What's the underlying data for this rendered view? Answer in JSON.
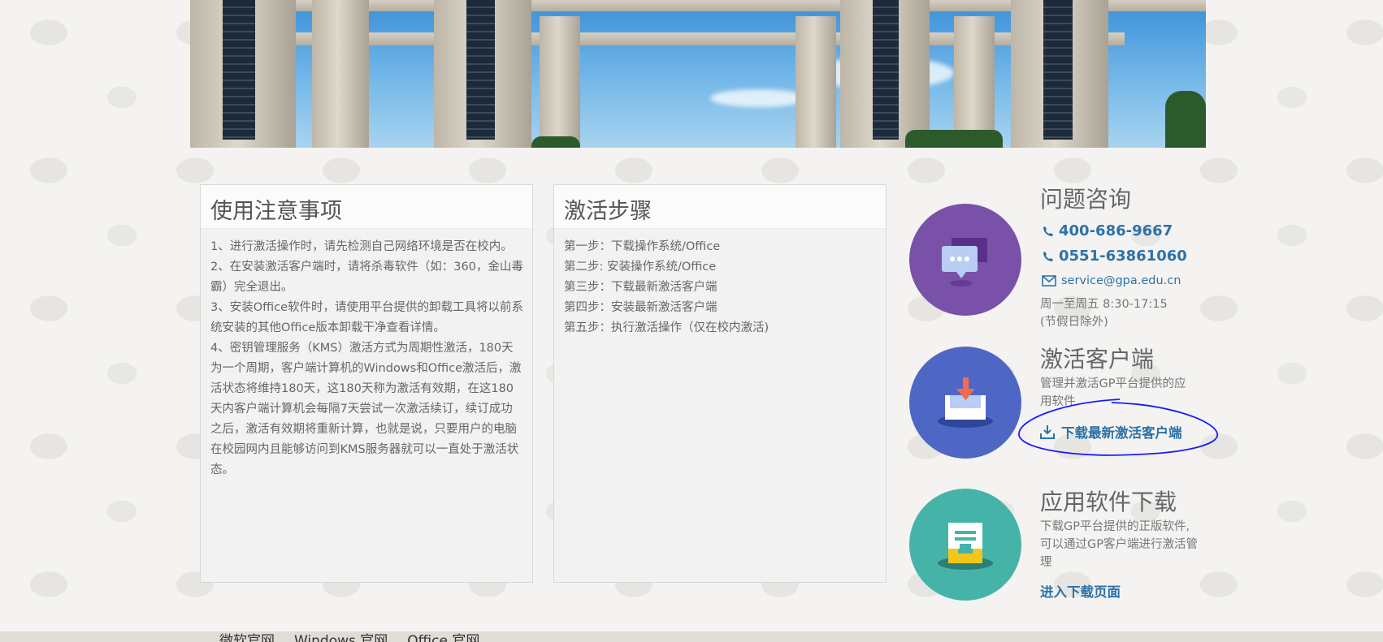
{
  "notes_card": {
    "title": "使用注意事项",
    "items": [
      "1、进行激活操作时，请先检测自己网络环境是否在校内。",
      "2、在安装激活客户端时，请将杀毒软件（如：360，金山毒霸）完全退出。",
      "3、安装Office软件时，请使用平台提供的卸载工具将以前系统安装的其他Office版本卸载干净查看详情。",
      "4、密钥管理服务（KMS）激活方式为周期性激活，180天为一个周期，客户端计算机的Windows和Office激活后，激活状态将维持180天，这180天称为激活有效期，在这180天内客户端计算机会每隔7天尝试一次激活续订，续订成功之后，激活有效期将重新计算，也就是说，只要用户的电脑在校园网内且能够访问到KMS服务器就可以一直处于激活状态。"
    ]
  },
  "steps_card": {
    "title": "激活步骤",
    "steps": [
      "第一步：下载操作系统/Office",
      "第二步: 安装操作系统/Office",
      "第三步：下载最新激活客户端",
      "第四步：安装最新激活客户端",
      "第五步：执行激活操作（仅在校内激活)"
    ]
  },
  "consult": {
    "title": "问题咨询",
    "phone1": "400-686-9667",
    "phone2": "0551-63861060",
    "email": "service@gpa.edu.cn",
    "hours": "周一至周五 8:30-17:15",
    "holiday": "(节假日除外)"
  },
  "client": {
    "title": "激活客户端",
    "desc": "管理并激活GP平台提供的应用软件",
    "download_link": "下载最新激活客户端"
  },
  "software": {
    "title": "应用软件下载",
    "desc": "下载GP平台提供的正版软件,可以通过GP客户端进行激活管理",
    "link": "进入下载页面"
  },
  "footer": {
    "links": [
      "微软官网",
      "Windows 官网",
      "Office 官网"
    ]
  },
  "colors": {
    "link_blue": "#2c72a8",
    "purple": "#7a51a8",
    "blue": "#4e67c4",
    "teal": "#46b3a9",
    "annotation": "#1a1aff"
  },
  "icons": [
    "chat-bubble-icon",
    "download-tray-icon",
    "software-box-icon",
    "phone-icon",
    "mail-icon",
    "download-icon"
  ]
}
